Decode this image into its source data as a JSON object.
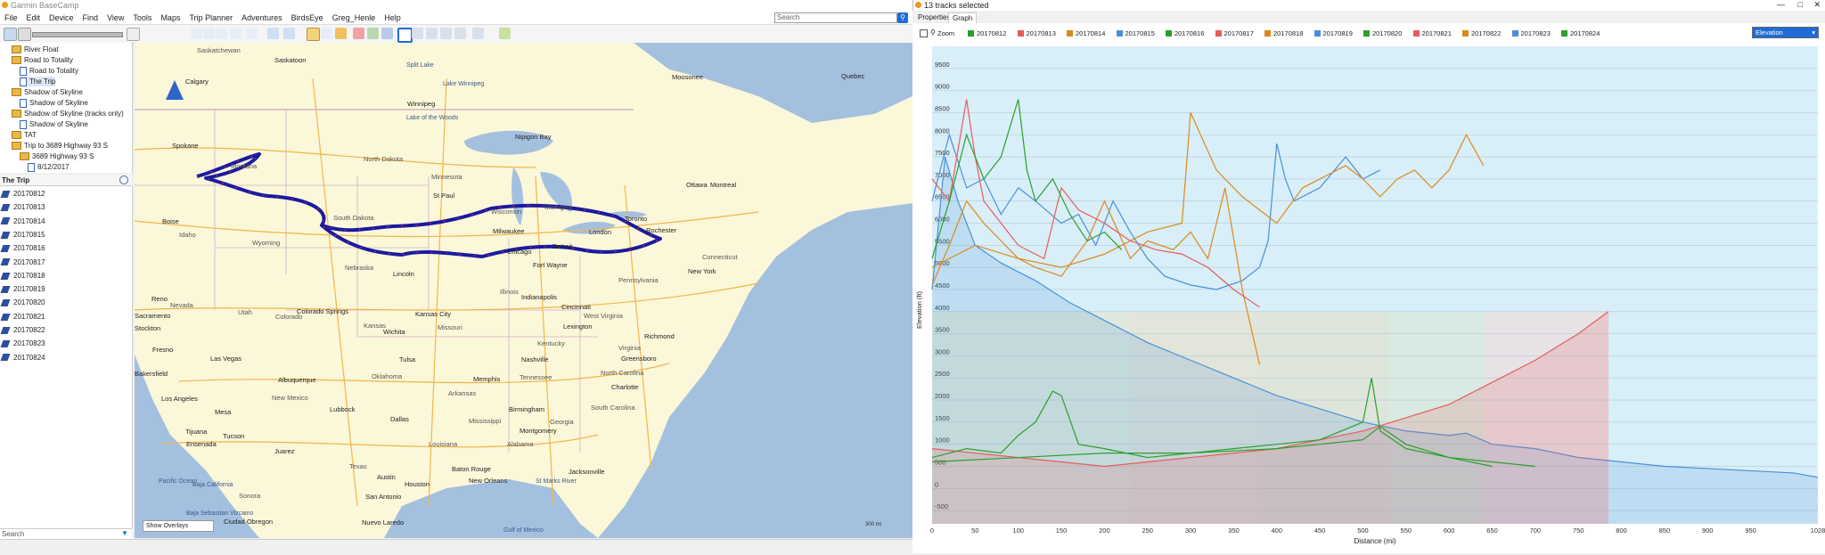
{
  "app": {
    "title": "Garmin BaseCamp"
  },
  "menu": [
    "File",
    "Edit",
    "Device",
    "Find",
    "View",
    "Tools",
    "Maps",
    "Trip Planner",
    "Adventures",
    "BirdsEye",
    "Greg_Henle",
    "Help"
  ],
  "search": {
    "placeholder": "Search"
  },
  "tree": [
    {
      "label": "River Float",
      "kind": "folder",
      "indent": 1
    },
    {
      "label": "Road to Totality",
      "kind": "folder",
      "indent": 1
    },
    {
      "label": "Road to Totality",
      "kind": "doc",
      "indent": 2
    },
    {
      "label": "The Trip",
      "kind": "doc",
      "indent": 2
    },
    {
      "label": "Shadow of Skyline",
      "kind": "folder",
      "indent": 1
    },
    {
      "label": "Shadow of Skyline",
      "kind": "doc",
      "indent": 2
    },
    {
      "label": "Shadow of Skyline (tracks only)",
      "kind": "folder",
      "indent": 1
    },
    {
      "label": "Shadow of Skyline",
      "kind": "doc",
      "indent": 2
    },
    {
      "label": "TAT",
      "kind": "folder",
      "indent": 1
    },
    {
      "label": "Trip to 3689 Highway 93 S",
      "kind": "folder",
      "indent": 1
    },
    {
      "label": "3689 Highway 93 S",
      "kind": "folder",
      "indent": 2
    },
    {
      "label": "8/12/2017",
      "kind": "doc",
      "indent": 3
    }
  ],
  "list": {
    "title": "The Trip",
    "tracks": [
      "20170812",
      "20170813",
      "20170814",
      "20170815",
      "20170816",
      "20170817",
      "20170818",
      "20170819",
      "20170820",
      "20170821",
      "20170822",
      "20170823",
      "20170824"
    ]
  },
  "left_search": {
    "placeholder": "Search"
  },
  "map": {
    "overlay_select": "Show Overlays",
    "scale": "300 mi",
    "labels": [
      {
        "t": "Saskatchewan",
        "c": "st",
        "x": 70,
        "y": 4
      },
      {
        "t": "Saskatoon",
        "c": "",
        "x": 157,
        "y": 15
      },
      {
        "t": "Calgary",
        "c": "",
        "x": 57,
        "y": 39
      },
      {
        "t": "Lake Winnipeg",
        "c": "sea",
        "x": 346,
        "y": 43
      },
      {
        "t": "Winnipeg",
        "c": "",
        "x": 306,
        "y": 64
      },
      {
        "t": "Lake of the Woods",
        "c": "sea",
        "x": 305,
        "y": 81
      },
      {
        "t": "Split Lake",
        "c": "sea",
        "x": 305,
        "y": 22
      },
      {
        "t": "Moosonee",
        "c": "",
        "x": 603,
        "y": 34
      },
      {
        "t": "Nipigon Bay",
        "c": "",
        "x": 427,
        "y": 101
      },
      {
        "t": "Spokane",
        "c": "",
        "x": 42,
        "y": 111
      },
      {
        "t": "Montana",
        "c": "st",
        "x": 108,
        "y": 134
      },
      {
        "t": "North Dakota",
        "c": "st",
        "x": 257,
        "y": 126
      },
      {
        "t": "Minnesota",
        "c": "st",
        "x": 333,
        "y": 146
      },
      {
        "t": "St Paul",
        "c": "",
        "x": 335,
        "y": 167
      },
      {
        "t": "Wisconsin",
        "c": "st",
        "x": 400,
        "y": 185
      },
      {
        "t": "Michigan",
        "c": "st",
        "x": 460,
        "y": 180
      },
      {
        "t": "Ottawa",
        "c": "",
        "x": 619,
        "y": 155
      },
      {
        "t": "Montreal",
        "c": "",
        "x": 646,
        "y": 155
      },
      {
        "t": "Toronto",
        "c": "",
        "x": 550,
        "y": 193
      },
      {
        "t": "London",
        "c": "",
        "x": 510,
        "y": 208
      },
      {
        "t": "Rochester",
        "c": "",
        "x": 574,
        "y": 206
      },
      {
        "t": "South Dakota",
        "c": "st",
        "x": 223,
        "y": 192
      },
      {
        "t": "Wyoming",
        "c": "st",
        "x": 132,
        "y": 220
      },
      {
        "t": "Boise",
        "c": "",
        "x": 31,
        "y": 196
      },
      {
        "t": "Idaho",
        "c": "st",
        "x": 50,
        "y": 211
      },
      {
        "t": "Nebraska",
        "c": "st",
        "x": 236,
        "y": 248
      },
      {
        "t": "Lincoln",
        "c": "",
        "x": 290,
        "y": 255
      },
      {
        "t": "Milwaukee",
        "c": "",
        "x": 402,
        "y": 207
      },
      {
        "t": "Chicago",
        "c": "",
        "x": 418,
        "y": 230
      },
      {
        "t": "Detroit",
        "c": "",
        "x": 469,
        "y": 224
      },
      {
        "t": "Fort Wayne",
        "c": "",
        "x": 447,
        "y": 245
      },
      {
        "t": "Pennsylvania",
        "c": "st",
        "x": 543,
        "y": 262
      },
      {
        "t": "New York",
        "c": "",
        "x": 621,
        "y": 252
      },
      {
        "t": "Connecticut",
        "c": "st",
        "x": 637,
        "y": 236
      },
      {
        "t": "Reno",
        "c": "",
        "x": 19,
        "y": 283
      },
      {
        "t": "Nevada",
        "c": "st",
        "x": 40,
        "y": 290
      },
      {
        "t": "Utah",
        "c": "st",
        "x": 116,
        "y": 298
      },
      {
        "t": "Colorado",
        "c": "st",
        "x": 158,
        "y": 303
      },
      {
        "t": "Colorado Springs",
        "c": "",
        "x": 182,
        "y": 297
      },
      {
        "t": "Kansas",
        "c": "st",
        "x": 257,
        "y": 313
      },
      {
        "t": "Kansas City",
        "c": "",
        "x": 315,
        "y": 300
      },
      {
        "t": "Missouri",
        "c": "st",
        "x": 340,
        "y": 315
      },
      {
        "t": "Illinois",
        "c": "st",
        "x": 410,
        "y": 275
      },
      {
        "t": "Indianapolis",
        "c": "",
        "x": 434,
        "y": 281
      },
      {
        "t": "Cincinnati",
        "c": "",
        "x": 479,
        "y": 292
      },
      {
        "t": "West Virginia",
        "c": "st",
        "x": 504,
        "y": 302
      },
      {
        "t": "Virginia",
        "c": "st",
        "x": 543,
        "y": 338
      },
      {
        "t": "Richmond",
        "c": "",
        "x": 572,
        "y": 325
      },
      {
        "t": "Lexington",
        "c": "",
        "x": 481,
        "y": 314
      },
      {
        "t": "Kentucky",
        "c": "st",
        "x": 452,
        "y": 333
      },
      {
        "t": "Sacramento",
        "c": "",
        "x": 0,
        "y": 302
      },
      {
        "t": "Stockton",
        "c": "",
        "x": 0,
        "y": 316
      },
      {
        "t": "Fresno",
        "c": "",
        "x": 20,
        "y": 340
      },
      {
        "t": "Las Vegas",
        "c": "",
        "x": 85,
        "y": 350
      },
      {
        "t": "Wichita",
        "c": "",
        "x": 279,
        "y": 320
      },
      {
        "t": "Tulsa",
        "c": "",
        "x": 297,
        "y": 351
      },
      {
        "t": "Oklahoma",
        "c": "st",
        "x": 266,
        "y": 370
      },
      {
        "t": "Nashville",
        "c": "",
        "x": 434,
        "y": 351
      },
      {
        "t": "Tennessee",
        "c": "st",
        "x": 432,
        "y": 371
      },
      {
        "t": "Memphis",
        "c": "",
        "x": 380,
        "y": 373
      },
      {
        "t": "Greensboro",
        "c": "",
        "x": 546,
        "y": 350
      },
      {
        "t": "North Carolina",
        "c": "st",
        "x": 523,
        "y": 366
      },
      {
        "t": "Charlotte",
        "c": "",
        "x": 535,
        "y": 382
      },
      {
        "t": "Bakersfield",
        "c": "",
        "x": 0,
        "y": 367
      },
      {
        "t": "Albuquerque",
        "c": "",
        "x": 161,
        "y": 374
      },
      {
        "t": "New Mexico",
        "c": "st",
        "x": 154,
        "y": 394
      },
      {
        "t": "Los Angeles",
        "c": "",
        "x": 30,
        "y": 395
      },
      {
        "t": "Arkansas",
        "c": "st",
        "x": 352,
        "y": 389
      },
      {
        "t": "Mississippi",
        "c": "st",
        "x": 375,
        "y": 420
      },
      {
        "t": "Birmingham",
        "c": "",
        "x": 420,
        "y": 407
      },
      {
        "t": "Georgia",
        "c": "st",
        "x": 466,
        "y": 421
      },
      {
        "t": "South Carolina",
        "c": "st",
        "x": 512,
        "y": 405
      },
      {
        "t": "Lubbock",
        "c": "",
        "x": 219,
        "y": 407
      },
      {
        "t": "Mesa",
        "c": "",
        "x": 90,
        "y": 410
      },
      {
        "t": "Dallas",
        "c": "",
        "x": 287,
        "y": 418
      },
      {
        "t": "Louisiana",
        "c": "st",
        "x": 330,
        "y": 446
      },
      {
        "t": "Alabama",
        "c": "st",
        "x": 418,
        "y": 446
      },
      {
        "t": "Montgomery",
        "c": "",
        "x": 432,
        "y": 431
      },
      {
        "t": "Tucson",
        "c": "",
        "x": 99,
        "y": 437
      },
      {
        "t": "Juarez",
        "c": "",
        "x": 157,
        "y": 454
      },
      {
        "t": "Texas",
        "c": "st",
        "x": 241,
        "y": 471
      },
      {
        "t": "Austin",
        "c": "",
        "x": 272,
        "y": 483
      },
      {
        "t": "Houston",
        "c": "",
        "x": 303,
        "y": 491
      },
      {
        "t": "Baton Rouge",
        "c": "",
        "x": 356,
        "y": 474
      },
      {
        "t": "New Orleans",
        "c": "",
        "x": 375,
        "y": 487
      },
      {
        "t": "Jacksonville",
        "c": "",
        "x": 487,
        "y": 477
      },
      {
        "t": "St Marks River",
        "c": "sea",
        "x": 450,
        "y": 489
      },
      {
        "t": "San Antonio",
        "c": "",
        "x": 259,
        "y": 505
      },
      {
        "t": "Pacific Ocean",
        "c": "sea",
        "x": 27,
        "y": 489
      },
      {
        "t": "Baja California",
        "c": "sea",
        "x": 65,
        "y": 493
      },
      {
        "t": "Sonora",
        "c": "st",
        "x": 117,
        "y": 504
      },
      {
        "t": "Ensenada",
        "c": "",
        "x": 58,
        "y": 446
      },
      {
        "t": "Tijuana",
        "c": "",
        "x": 57,
        "y": 432
      },
      {
        "t": "Ciudad Obregon",
        "c": "",
        "x": 100,
        "y": 533
      },
      {
        "t": "Baja Sebastian Vizcaino",
        "c": "sea",
        "x": 58,
        "y": 525
      },
      {
        "t": "Nuevo Laredo",
        "c": "",
        "x": 255,
        "y": 534
      },
      {
        "t": "Gulf of Mexico",
        "c": "sea",
        "x": 414,
        "y": 544
      },
      {
        "t": "Quebec",
        "c": "",
        "x": 793,
        "y": 33
      }
    ]
  },
  "graph": {
    "window_title": "13 tracks selected",
    "tabs": [
      "Properties",
      "Graph"
    ],
    "zoom_label": "Zoom",
    "metric": "Elevation",
    "legend": [
      {
        "name": "20170812",
        "color": "#2aa02a"
      },
      {
        "name": "20170813",
        "color": "#e85b5b"
      },
      {
        "name": "20170814",
        "color": "#d98a1a"
      },
      {
        "name": "20170815",
        "color": "#4a90d9"
      },
      {
        "name": "20170816",
        "color": "#2aa02a"
      },
      {
        "name": "20170817",
        "color": "#e85b5b"
      },
      {
        "name": "20170818",
        "color": "#d98a1a"
      },
      {
        "name": "20170819",
        "color": "#4a90d9"
      },
      {
        "name": "20170820",
        "color": "#2aa02a"
      },
      {
        "name": "20170821",
        "color": "#e85b5b"
      },
      {
        "name": "20170822",
        "color": "#d98a1a"
      },
      {
        "name": "20170823",
        "color": "#4a90d9"
      },
      {
        "name": "20170824",
        "color": "#2aa02a"
      }
    ]
  },
  "chart_data": {
    "type": "line",
    "title": "",
    "xlabel": "Distance (mi)",
    "ylabel": "Elevation (ft)",
    "xlim": [
      0,
      1028
    ],
    "ylim": [
      -800,
      10000
    ],
    "xticks": [
      0,
      50,
      100,
      150,
      200,
      250,
      300,
      350,
      400,
      450,
      500,
      550,
      600,
      650,
      700,
      750,
      800,
      850,
      900,
      950,
      1028
    ],
    "yticks": [
      -500,
      0,
      500,
      1000,
      1500,
      2000,
      2500,
      3000,
      3500,
      4000,
      4500,
      5000,
      5500,
      6000,
      6500,
      7000,
      7500,
      8000,
      8500,
      9000,
      9500
    ],
    "grid": true,
    "series": [
      {
        "name": "20170812",
        "color": "#4a90d9",
        "area": true,
        "x": [
          0,
          15,
          30,
          50,
          80,
          120,
          160,
          200,
          250,
          300,
          350,
          400,
          450,
          500,
          550,
          600,
          620,
          650,
          700,
          750,
          800,
          850,
          900,
          950,
          1000,
          1028
        ],
        "y": [
          4500,
          7500,
          6500,
          5500,
          5100,
          4700,
          4200,
          3800,
          3300,
          2900,
          2500,
          2100,
          1800,
          1500,
          1300,
          1200,
          1250,
          1000,
          900,
          700,
          600,
          500,
          450,
          400,
          350,
          250
        ]
      },
      {
        "name": "20170815",
        "color": "#4a90d9",
        "x": [
          0,
          20,
          40,
          60,
          80,
          100,
          120,
          150,
          170,
          190,
          210,
          230,
          250,
          270,
          300,
          330,
          360,
          380,
          390,
          400,
          410,
          420,
          450,
          480,
          500,
          520
        ],
        "y": [
          6500,
          8000,
          6800,
          7000,
          6200,
          6800,
          6500,
          6000,
          6200,
          5500,
          6500,
          5800,
          5200,
          4800,
          4600,
          4500,
          4700,
          5000,
          5600,
          7800,
          7000,
          6500,
          6800,
          7500,
          7000,
          7200
        ]
      },
      {
        "name": "20170814",
        "color": "#d98a1a",
        "x": [
          0,
          20,
          40,
          60,
          80,
          100,
          120,
          150,
          180,
          200,
          230,
          250,
          280,
          300,
          320,
          340,
          360,
          380
        ],
        "y": [
          4600,
          5500,
          6500,
          6000,
          5600,
          5200,
          5000,
          4800,
          5600,
          6500,
          5200,
          5600,
          5400,
          5800,
          5200,
          6800,
          4500,
          2800
        ]
      },
      {
        "name": "20170818",
        "color": "#d98a1a",
        "x": [
          0,
          50,
          100,
          150,
          200,
          250,
          290,
          300,
          330,
          360,
          400,
          430,
          450,
          480,
          500,
          520,
          540,
          560,
          580,
          600,
          620,
          640
        ],
        "y": [
          5000,
          5500,
          5200,
          5000,
          5300,
          5800,
          6000,
          8500,
          7200,
          6600,
          6000,
          6800,
          7000,
          7300,
          7000,
          6600,
          7000,
          7200,
          6800,
          7200,
          8000,
          7300
        ]
      },
      {
        "name": "20170813",
        "color": "#e85b5b",
        "x": [
          0,
          20,
          40,
          50,
          60,
          80,
          100,
          130,
          150,
          170,
          200,
          230,
          260,
          290,
          320,
          350,
          380
        ],
        "y": [
          7000,
          6500,
          8800,
          7500,
          6500,
          6000,
          5500,
          5200,
          6800,
          6300,
          6000,
          5600,
          5400,
          5300,
          5000,
          4500,
          4100
        ]
      },
      {
        "name": "20170817",
        "color": "#e85b5b",
        "area": true,
        "x": [
          0,
          50,
          100,
          150,
          200,
          250,
          300,
          350,
          400,
          450,
          500,
          550,
          600,
          650,
          700,
          750,
          785
        ],
        "y": [
          900,
          800,
          700,
          600,
          500,
          600,
          700,
          800,
          900,
          1100,
          1300,
          1600,
          1900,
          2400,
          2900,
          3500,
          4000
        ]
      },
      {
        "name": "20170816",
        "color": "#2aa02a",
        "x": [
          0,
          20,
          40,
          60,
          80,
          100,
          110,
          120,
          140,
          160,
          180,
          200,
          220
        ],
        "y": [
          5200,
          6500,
          8000,
          7000,
          7500,
          8800,
          7200,
          6500,
          7000,
          6200,
          5600,
          5800,
          5400
        ]
      },
      {
        "name": "20170820",
        "color": "#2aa02a",
        "x": [
          0,
          40,
          80,
          100,
          120,
          140,
          150,
          170,
          200,
          250,
          300,
          350,
          400,
          450,
          500,
          510,
          520,
          550,
          600,
          650,
          700
        ],
        "y": [
          700,
          900,
          800,
          1200,
          1500,
          2200,
          2100,
          1000,
          900,
          700,
          800,
          900,
          1000,
          1100,
          1500,
          2500,
          1300,
          900,
          700,
          600,
          500
        ]
      },
      {
        "name": "20170822",
        "color": "#2aa02a",
        "x": [
          0,
          100,
          200,
          300,
          400,
          450,
          500,
          520,
          550,
          600,
          650
        ],
        "y": [
          600,
          700,
          800,
          800,
          900,
          1000,
          1100,
          1400,
          1000,
          700,
          500
        ]
      }
    ]
  }
}
